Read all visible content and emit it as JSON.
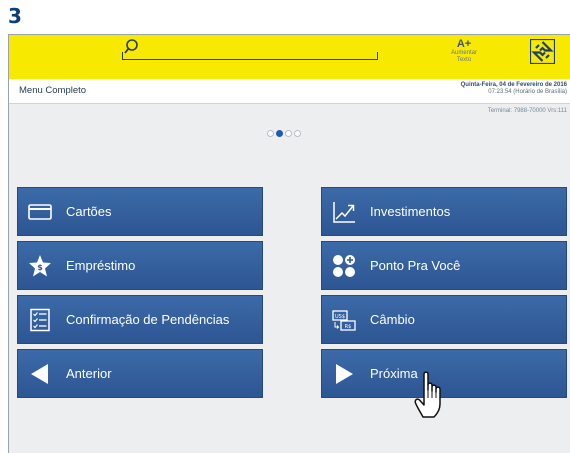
{
  "step_number": "3",
  "topbar": {
    "font_size_label": "A+",
    "font_size_caption_1": "Aumentar",
    "font_size_caption_2": "Texto"
  },
  "header": {
    "menu_title": "Menu Completo",
    "date": "Quinta-Feira, 04 de Fevereiro de 2016",
    "time": "07:23:54 (Horário de Brasília)",
    "terminal": "Terminal: 7988-70000 Vrs:111"
  },
  "pagination": {
    "pages": 4,
    "current": 2
  },
  "menu": {
    "left": [
      {
        "label": "Cartões",
        "icon": "card-icon"
      },
      {
        "label": "Empréstimo",
        "icon": "star-dollar-icon"
      },
      {
        "label": "Confirmação de Pendências",
        "icon": "checklist-icon"
      },
      {
        "label": "Anterior",
        "icon": "arrow-left-icon"
      }
    ],
    "right": [
      {
        "label": "Investimentos",
        "icon": "chart-up-icon"
      },
      {
        "label": "Ponto Pra Você",
        "icon": "points-icon"
      },
      {
        "label": "Câmbio",
        "icon": "exchange-icon"
      },
      {
        "label": "Próxima",
        "icon": "arrow-right-icon"
      }
    ]
  },
  "colors": {
    "topbar": "#f7ea00",
    "tile": "#2f5a97",
    "step": "#0b3e7a",
    "active_dot": "#1d5bb5"
  }
}
